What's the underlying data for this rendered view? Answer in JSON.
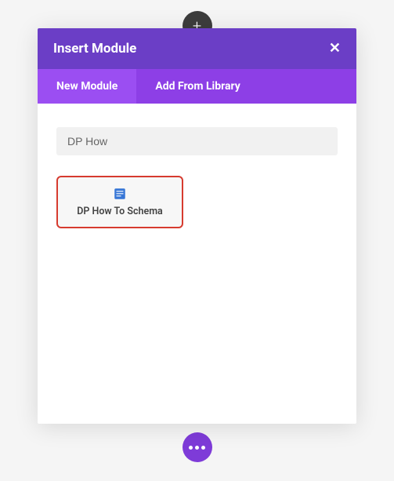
{
  "addIcon": "+",
  "modal": {
    "title": "Insert Module",
    "closeLabel": "✕",
    "tabs": {
      "newModule": "New Module",
      "addFromLibrary": "Add From Library"
    },
    "searchValue": "DP How",
    "module": {
      "label": "DP How To Schema"
    }
  }
}
